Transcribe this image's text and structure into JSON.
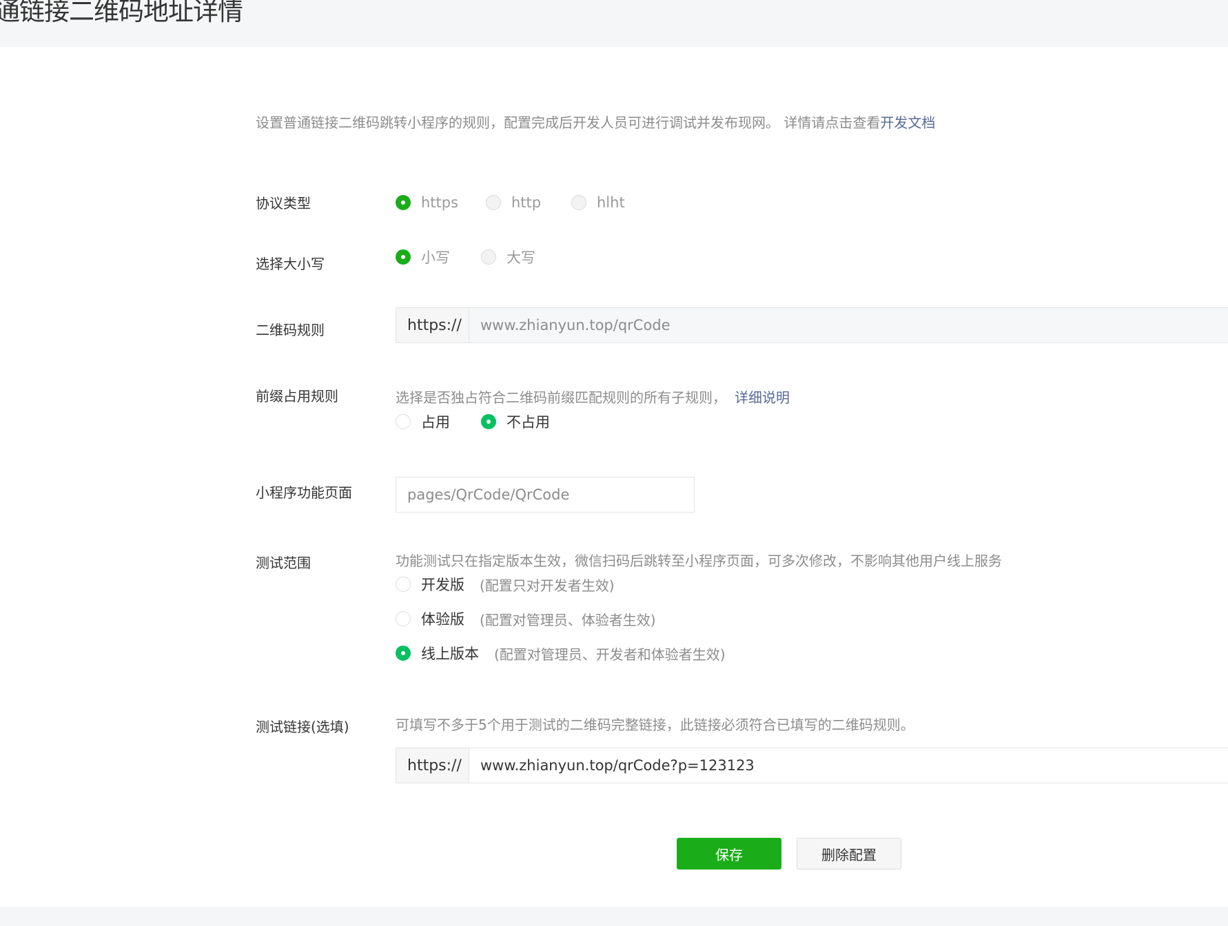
{
  "page": {
    "title": "通链接二维码地址详情"
  },
  "intro": {
    "text": "设置普通链接二维码跳转小程序的规则，配置完成后开发人员可进行调试并发布现网。 详情请点击查看",
    "link": "开发文档"
  },
  "protocol": {
    "label": "协议类型",
    "options": [
      "https",
      "http",
      "hlht"
    ],
    "selected": "https"
  },
  "case": {
    "label": "选择大小写",
    "options": [
      "小写",
      "大写"
    ],
    "selected": "小写"
  },
  "qr_rule": {
    "label": "二维码规则",
    "prefix": "https://",
    "value": "www.zhianyun.top/qrCode"
  },
  "prefix_rule": {
    "label": "前缀占用规则",
    "hint": "选择是否独占符合二维码前缀匹配规则的所有子规则，",
    "hint_link": "详细说明",
    "options": [
      "占用",
      "不占用"
    ],
    "selected": "不占用"
  },
  "mini_page": {
    "label": "小程序功能页面",
    "value": "pages/QrCode/QrCode"
  },
  "test_scope": {
    "label": "测试范围",
    "hint": "功能测试只在指定版本生效，微信扫码后跳转至小程序页面，可多次修改，不影响其他用户线上服务",
    "options": [
      {
        "label": "开发版",
        "note": "(配置只对开发者生效)"
      },
      {
        "label": "体验版",
        "note": "(配置对管理员、体验者生效)"
      },
      {
        "label": "线上版本",
        "note": "(配置对管理员、开发者和体验者生效)"
      }
    ],
    "selected": "线上版本"
  },
  "test_link": {
    "label": "测试链接(选填)",
    "hint": "可填写不多于5个用于测试的二维码完整链接，此链接必须符合已填写的二维码规则。",
    "prefix": "https://",
    "value": "www.zhianyun.top/qrCode?p=123123"
  },
  "actions": {
    "save": "保存",
    "delete": "删除配置"
  },
  "colors": {
    "primary": "#1aad19",
    "selected_radio_bright": "#07c160",
    "link": "#576b95",
    "muted_text": "#8c8c8c"
  }
}
